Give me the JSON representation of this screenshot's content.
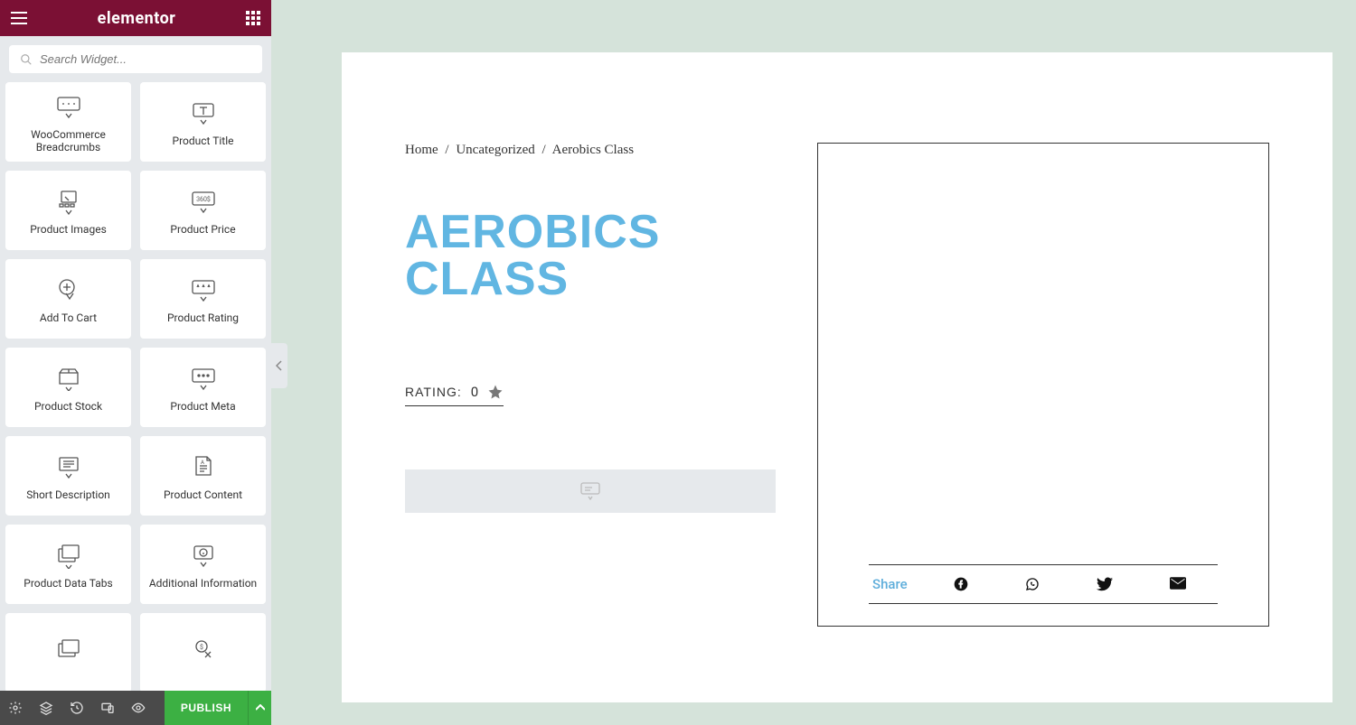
{
  "app": {
    "logo": "elementor",
    "search_placeholder": "Search Widget..."
  },
  "widgets": [
    {
      "id": "woo-breadcrumbs",
      "label": "WooCommerce Breadcrumbs"
    },
    {
      "id": "product-title",
      "label": "Product Title"
    },
    {
      "id": "product-images",
      "label": "Product Images"
    },
    {
      "id": "product-price",
      "label": "Product Price"
    },
    {
      "id": "add-to-cart",
      "label": "Add To Cart"
    },
    {
      "id": "product-rating",
      "label": "Product Rating"
    },
    {
      "id": "product-stock",
      "label": "Product Stock"
    },
    {
      "id": "product-meta",
      "label": "Product Meta"
    },
    {
      "id": "short-description",
      "label": "Short Description"
    },
    {
      "id": "product-content",
      "label": "Product Content"
    },
    {
      "id": "product-data-tabs",
      "label": "Product Data Tabs"
    },
    {
      "id": "additional-info",
      "label": "Additional Information"
    }
  ],
  "footer": {
    "publish": "PUBLISH"
  },
  "canvas": {
    "breadcrumb": {
      "home": "Home",
      "category": "Uncategorized",
      "current": "Aerobics Class"
    },
    "title": "AEROBICS CLASS",
    "rating": {
      "label": "RATING:",
      "value": "0"
    },
    "share": {
      "label": "Share"
    }
  },
  "colors": {
    "brand": "#7b1034",
    "accent": "#61b6e2",
    "publish": "#3cb043",
    "panel": "#e6e9ec",
    "page_bg": "#d5e3da"
  }
}
